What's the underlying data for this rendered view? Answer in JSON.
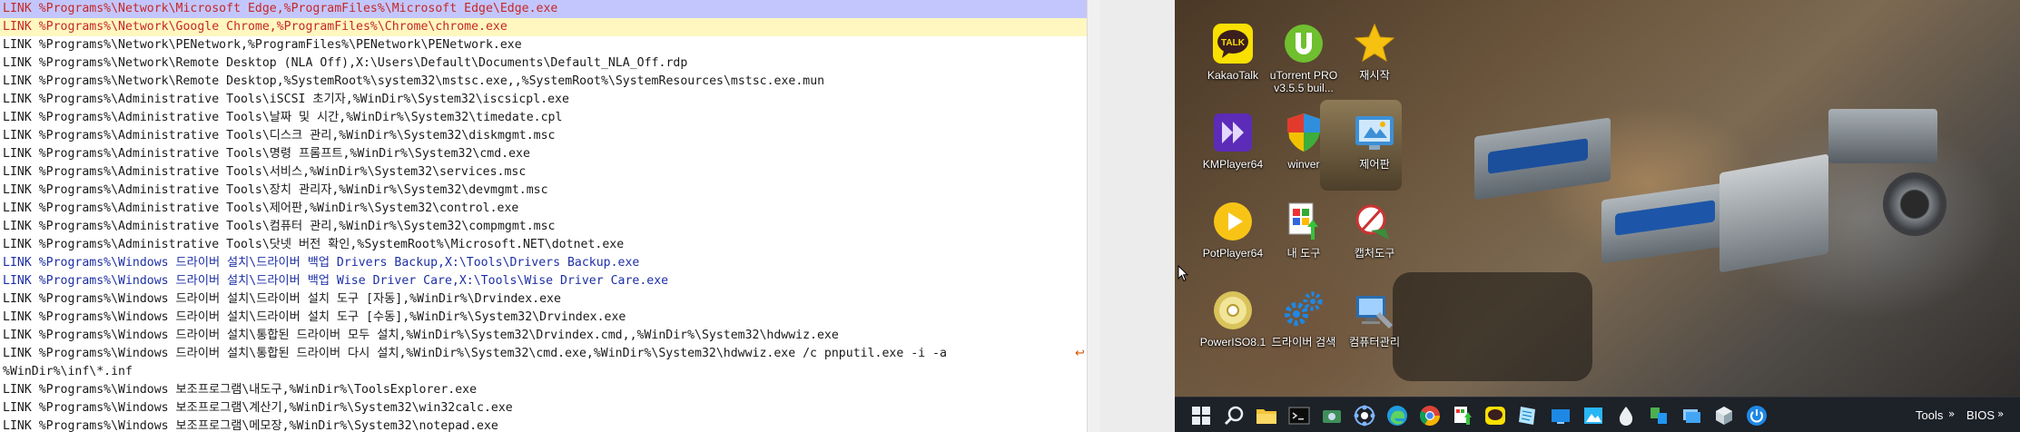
{
  "editor": {
    "lines": [
      {
        "text": "LINK %Programs%\\Network\\Microsoft Edge,%ProgramFiles%\\Microsoft Edge\\Edge.exe",
        "style": "sel"
      },
      {
        "text": "LINK %Programs%\\Network\\Google Chrome,%ProgramFiles%\\Chrome\\chrome.exe",
        "style": "cur"
      },
      {
        "text": "LINK %Programs%\\Network\\PENetwork,%ProgramFiles%\\PENetwork\\PENetwork.exe",
        "style": ""
      },
      {
        "text": "LINK %Programs%\\Network\\Remote Desktop (NLA Off),X:\\Users\\Default\\Documents\\Default_NLA_Off.rdp",
        "style": ""
      },
      {
        "text": "LINK %Programs%\\Network\\Remote Desktop,%SystemRoot%\\system32\\mstsc.exe,,%SystemRoot%\\SystemResources\\mstsc.exe.mun",
        "style": ""
      },
      {
        "text": "LINK %Programs%\\Administrative Tools\\iSCSI 초기자,%WinDir%\\System32\\iscsicpl.exe",
        "style": ""
      },
      {
        "text": "LINK %Programs%\\Administrative Tools\\날짜 및 시간,%WinDir%\\System32\\timedate.cpl",
        "style": ""
      },
      {
        "text": "LINK %Programs%\\Administrative Tools\\디스크 관리,%WinDir%\\System32\\diskmgmt.msc",
        "style": ""
      },
      {
        "text": "LINK %Programs%\\Administrative Tools\\명령 프롬프트,%WinDir%\\System32\\cmd.exe",
        "style": ""
      },
      {
        "text": "LINK %Programs%\\Administrative Tools\\서비스,%WinDir%\\System32\\services.msc",
        "style": ""
      },
      {
        "text": "LINK %Programs%\\Administrative Tools\\장치 관리자,%WinDir%\\System32\\devmgmt.msc",
        "style": ""
      },
      {
        "text": "LINK %Programs%\\Administrative Tools\\제어판,%WinDir%\\System32\\control.exe",
        "style": ""
      },
      {
        "text": "LINK %Programs%\\Administrative Tools\\컴퓨터 관리,%WinDir%\\System32\\compmgmt.msc",
        "style": ""
      },
      {
        "text": "LINK %Programs%\\Administrative Tools\\닷넷 버전 확인,%SystemRoot%\\Microsoft.NET\\dotnet.exe",
        "style": ""
      },
      {
        "text": "LINK %Programs%\\Windows 드라이버 설치\\드라이버 백업 Drivers Backup,X:\\Tools\\Drivers Backup.exe",
        "style": "blue"
      },
      {
        "text": "LINK %Programs%\\Windows 드라이버 설치\\드라이버 백업 Wise Driver Care,X:\\Tools\\Wise Driver Care.exe",
        "style": "blue"
      },
      {
        "text": "LINK %Programs%\\Windows 드라이버 설치\\드라이버 설치 도구 [자동],%WinDir%\\Drvindex.exe",
        "style": ""
      },
      {
        "text": "LINK %Programs%\\Windows 드라이버 설치\\드라이버 설치 도구 [수동],%WinDir%\\System32\\Drvindex.exe",
        "style": ""
      },
      {
        "text": "LINK %Programs%\\Windows 드라이버 설치\\통합된 드라이버 모두 설치,%WinDir%\\System32\\Drvindex.cmd,,%WinDir%\\System32\\hdwwiz.exe",
        "style": ""
      },
      {
        "text": "LINK %Programs%\\Windows 드라이버 설치\\통합된 드라이버 다시 설치,%WinDir%\\System32\\cmd.exe,%WinDir%\\System32\\hdwwiz.exe /c pnputil.exe -i -a",
        "style": ""
      },
      {
        "text": "%WinDir%\\inf\\*.inf",
        "style": ""
      },
      {
        "text": "LINK %Programs%\\Windows 보조프로그램\\내도구,%WinDir%\\ToolsExplorer.exe",
        "style": ""
      },
      {
        "text": "LINK %Programs%\\Windows 보조프로그램\\계산기,%WinDir%\\System32\\win32calc.exe",
        "style": ""
      },
      {
        "text": "LINK %Programs%\\Windows 보조프로그램\\메모장,%WinDir%\\System32\\notepad.exe",
        "style": ""
      }
    ],
    "wrap_marker": "↩"
  },
  "desktop": {
    "icons": [
      {
        "label": "KakaoTalk",
        "icon": "kakaotalk-icon"
      },
      {
        "label": "uTorrent PRO v3.5.5 buil...",
        "icon": "utorrent-icon"
      },
      {
        "label": "재시작",
        "icon": "restart-star-icon"
      },
      {
        "label": "KMPlayer64",
        "icon": "kmplayer-icon"
      },
      {
        "label": "winver",
        "icon": "winver-shield-icon"
      },
      {
        "label": "제어판",
        "icon": "control-panel-icon"
      },
      {
        "label": "PotPlayer64",
        "icon": "potplayer-icon"
      },
      {
        "label": "내 도구",
        "icon": "my-tools-icon"
      },
      {
        "label": "캡처도구",
        "icon": "capture-tool-icon"
      },
      {
        "label": "PowerISO8.1",
        "icon": "poweriso-icon"
      },
      {
        "label": "드라이버 검색",
        "icon": "driver-search-icon"
      },
      {
        "label": "컴퓨터관리",
        "icon": "computer-management-icon"
      }
    ]
  },
  "taskbar": {
    "items": [
      "start-icon",
      "search-icon",
      "file-explorer-icon",
      "terminal-icon",
      "screen-capture-icon",
      "network-icon",
      "edge-icon",
      "chrome-icon",
      "tools-icon",
      "kakaotalk-icon",
      "notes-icon",
      "display-icon",
      "photo-icon",
      "water-drop-icon",
      "task-icon",
      "stack-icon",
      "cube-icon",
      "power-icon"
    ],
    "tools_label": "Tools",
    "bios_label": "BIOS",
    "chevron": "»"
  },
  "colors": {
    "selection": "#c3c6fc",
    "current_line": "#fff7bf",
    "blue_text": "#1d2fa6",
    "red_text": "#c62828",
    "taskbar": "#1d2128"
  }
}
